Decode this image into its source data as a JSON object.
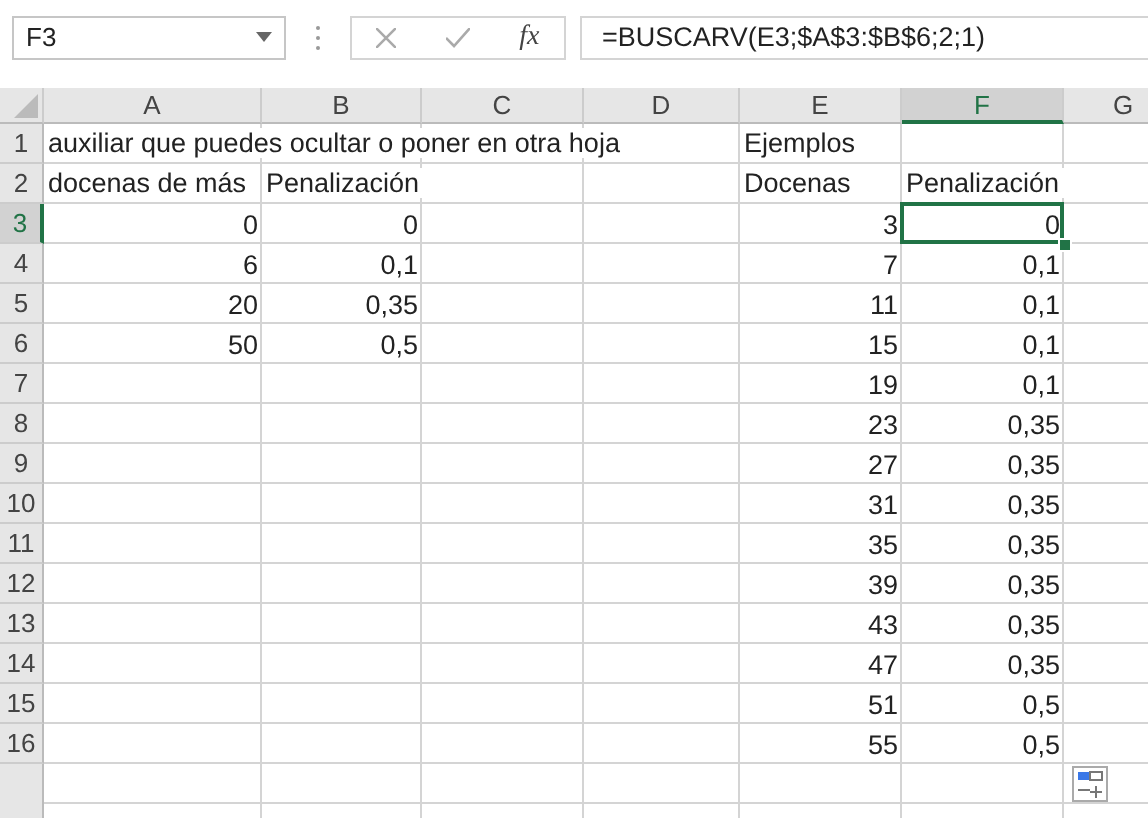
{
  "formula_bar": {
    "name_box": "F3",
    "insert_function": "fx",
    "formula": "=BUSCARV(E3;$A$3:$B$6;2;1)"
  },
  "columns": [
    {
      "label": "A",
      "selected": false
    },
    {
      "label": "B",
      "selected": false
    },
    {
      "label": "C",
      "selected": false
    },
    {
      "label": "D",
      "selected": false
    },
    {
      "label": "E",
      "selected": false
    },
    {
      "label": "F",
      "selected": true
    },
    {
      "label": "G",
      "selected": false
    }
  ],
  "rows": [
    {
      "number": "1",
      "selected": false,
      "cells": [
        {
          "kind": "text",
          "text": "auxiliar que puedes ocultar o poner en otra hoja"
        },
        null,
        null,
        null,
        {
          "kind": "text",
          "text": "Ejemplos"
        },
        null,
        null
      ]
    },
    {
      "number": "2",
      "selected": false,
      "cells": [
        {
          "kind": "text",
          "text": "docenas de más"
        },
        {
          "kind": "text",
          "text": "Penalización"
        },
        null,
        null,
        {
          "kind": "text",
          "text": "Docenas"
        },
        {
          "kind": "text",
          "text": "Penalización"
        },
        null
      ]
    },
    {
      "number": "3",
      "selected": true,
      "cells": [
        {
          "kind": "number",
          "text": "0"
        },
        {
          "kind": "number",
          "text": "0"
        },
        null,
        null,
        {
          "kind": "number",
          "text": "3"
        },
        {
          "kind": "number",
          "text": "0"
        },
        null
      ]
    },
    {
      "number": "4",
      "selected": false,
      "cells": [
        {
          "kind": "number",
          "text": "6"
        },
        {
          "kind": "number",
          "text": "0,1"
        },
        null,
        null,
        {
          "kind": "number",
          "text": "7"
        },
        {
          "kind": "number",
          "text": "0,1"
        },
        null
      ]
    },
    {
      "number": "5",
      "selected": false,
      "cells": [
        {
          "kind": "number",
          "text": "20"
        },
        {
          "kind": "number",
          "text": "0,35"
        },
        null,
        null,
        {
          "kind": "number",
          "text": "11"
        },
        {
          "kind": "number",
          "text": "0,1"
        },
        null
      ]
    },
    {
      "number": "6",
      "selected": false,
      "cells": [
        {
          "kind": "number",
          "text": "50"
        },
        {
          "kind": "number",
          "text": "0,5"
        },
        null,
        null,
        {
          "kind": "number",
          "text": "15"
        },
        {
          "kind": "number",
          "text": "0,1"
        },
        null
      ]
    },
    {
      "number": "7",
      "selected": false,
      "cells": [
        null,
        null,
        null,
        null,
        {
          "kind": "number",
          "text": "19"
        },
        {
          "kind": "number",
          "text": "0,1"
        },
        null
      ]
    },
    {
      "number": "8",
      "selected": false,
      "cells": [
        null,
        null,
        null,
        null,
        {
          "kind": "number",
          "text": "23"
        },
        {
          "kind": "number",
          "text": "0,35"
        },
        null
      ]
    },
    {
      "number": "9",
      "selected": false,
      "cells": [
        null,
        null,
        null,
        null,
        {
          "kind": "number",
          "text": "27"
        },
        {
          "kind": "number",
          "text": "0,35"
        },
        null
      ]
    },
    {
      "number": "10",
      "selected": false,
      "cells": [
        null,
        null,
        null,
        null,
        {
          "kind": "number",
          "text": "31"
        },
        {
          "kind": "number",
          "text": "0,35"
        },
        null
      ]
    },
    {
      "number": "11",
      "selected": false,
      "cells": [
        null,
        null,
        null,
        null,
        {
          "kind": "number",
          "text": "35"
        },
        {
          "kind": "number",
          "text": "0,35"
        },
        null
      ]
    },
    {
      "number": "12",
      "selected": false,
      "cells": [
        null,
        null,
        null,
        null,
        {
          "kind": "number",
          "text": "39"
        },
        {
          "kind": "number",
          "text": "0,35"
        },
        null
      ]
    },
    {
      "number": "13",
      "selected": false,
      "cells": [
        null,
        null,
        null,
        null,
        {
          "kind": "number",
          "text": "43"
        },
        {
          "kind": "number",
          "text": "0,35"
        },
        null
      ]
    },
    {
      "number": "14",
      "selected": false,
      "cells": [
        null,
        null,
        null,
        null,
        {
          "kind": "number",
          "text": "47"
        },
        {
          "kind": "number",
          "text": "0,35"
        },
        null
      ]
    },
    {
      "number": "15",
      "selected": false,
      "cells": [
        null,
        null,
        null,
        null,
        {
          "kind": "number",
          "text": "51"
        },
        {
          "kind": "number",
          "text": "0,5"
        },
        null
      ]
    },
    {
      "number": "16",
      "selected": false,
      "cells": [
        null,
        null,
        null,
        null,
        {
          "kind": "number",
          "text": "55"
        },
        {
          "kind": "number",
          "text": "0,5"
        },
        null
      ]
    }
  ]
}
